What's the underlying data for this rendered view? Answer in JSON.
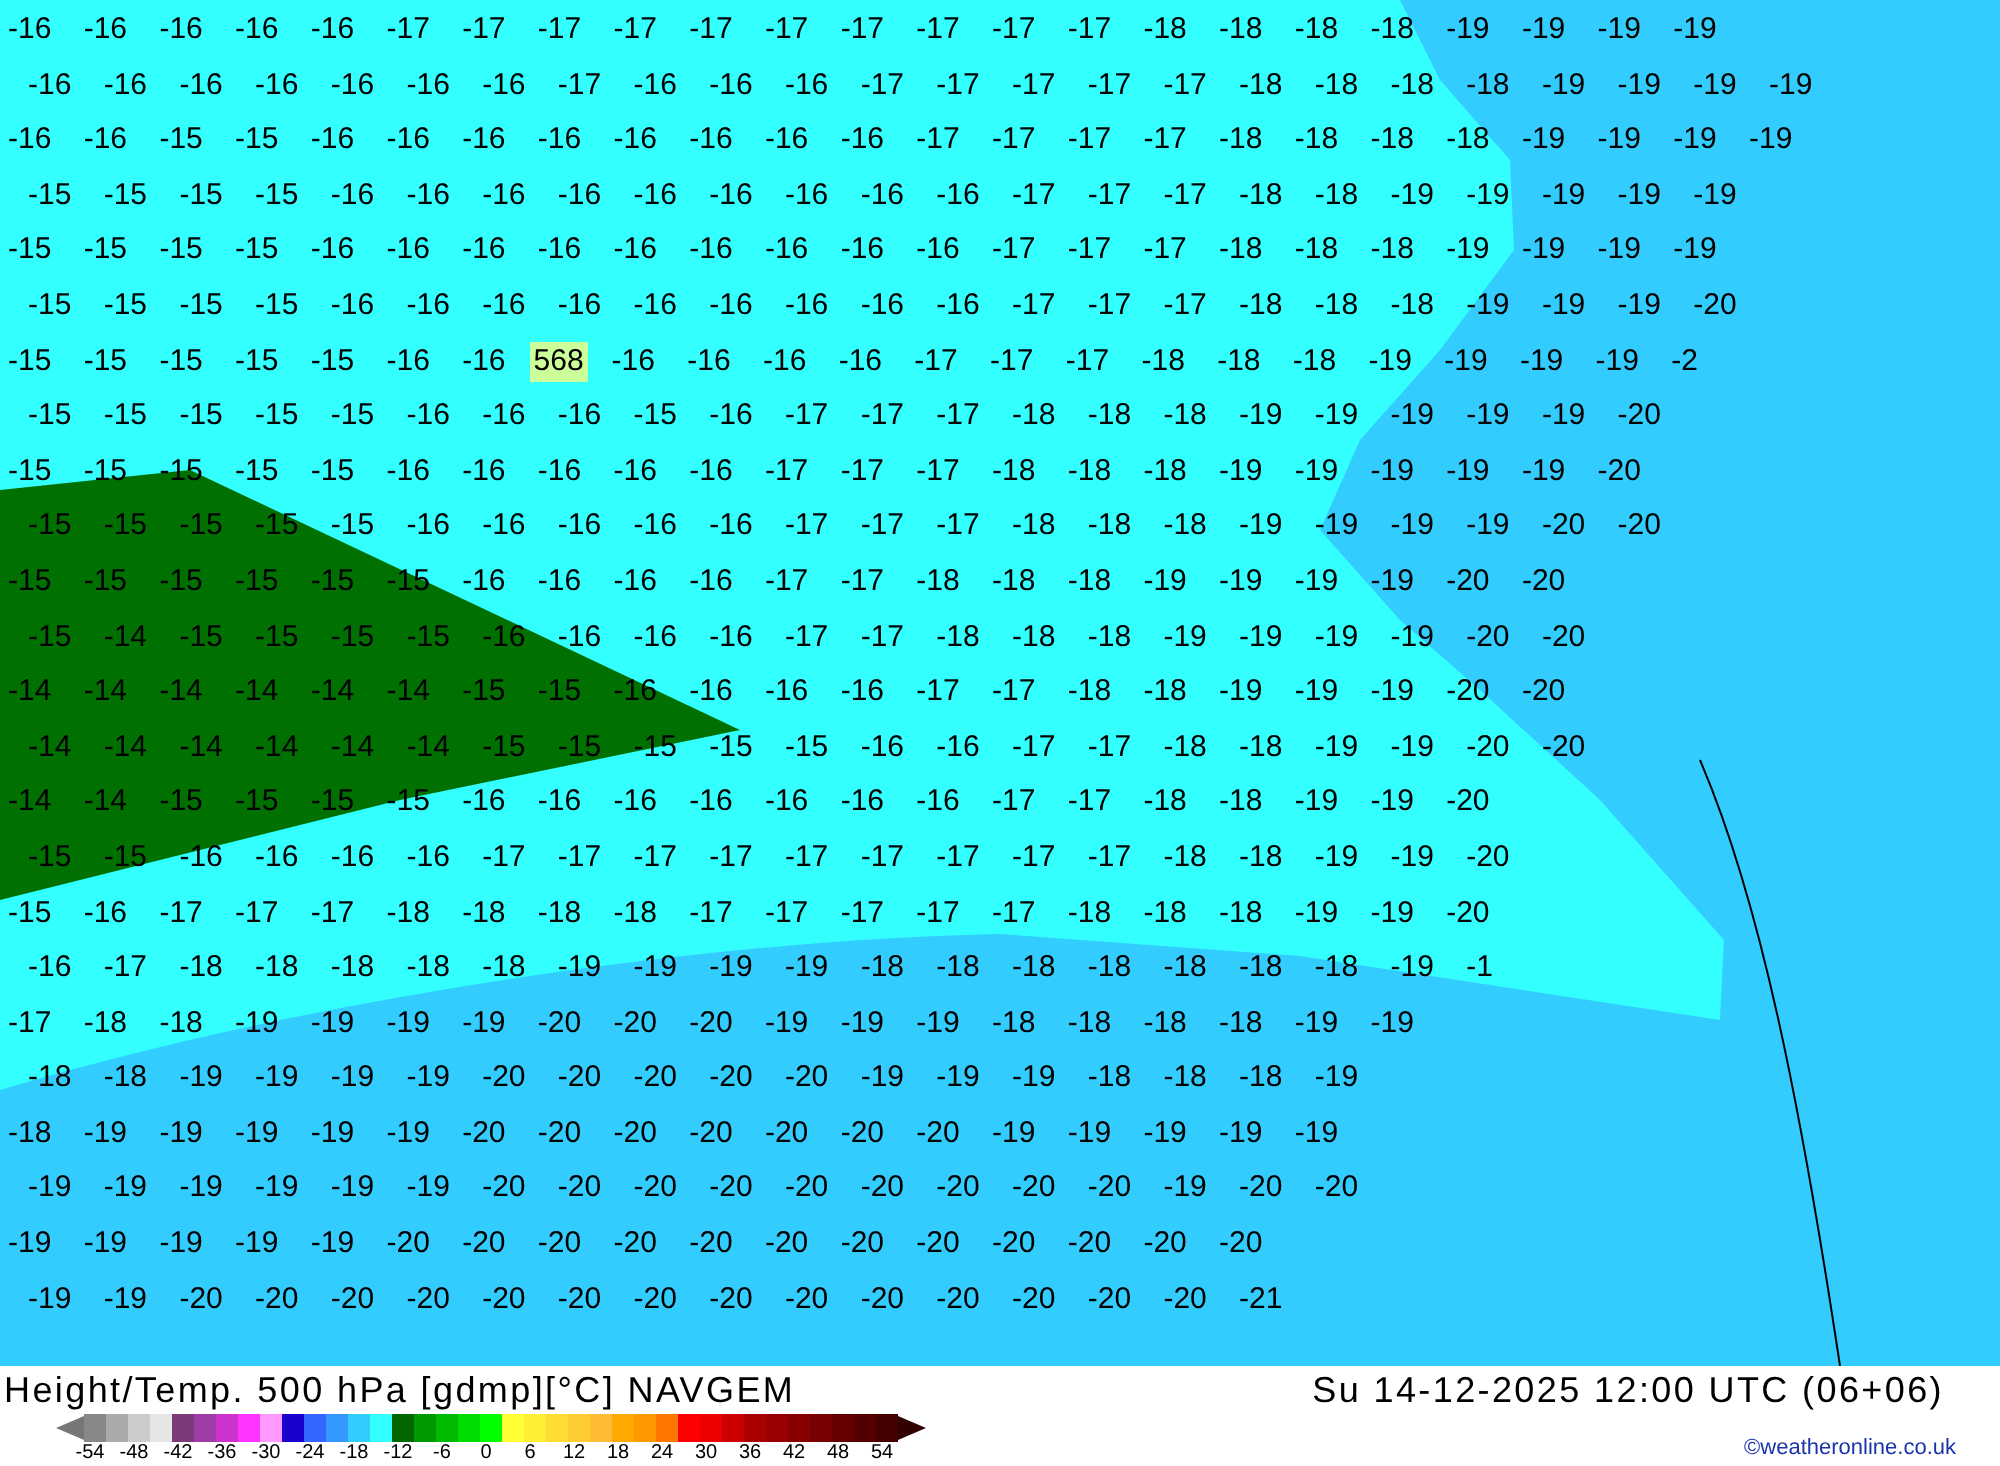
{
  "map": {
    "rows": [
      "-16 -16 -16 -16 -16 -17 -17 -17 -17 -17 -17 -17 -17 -17 -17 -18 -18 -18 -18 -19 -19 -19 -19",
      "-16 -16 -16 -16 -16 -16 -16 -17 -16 -16 -16 -17 -17 -17 -17 -17 -18 -18 -18 -18 -19 -19 -19 -19",
      "-16 -16 -15 -15 -16 -16 -16 -16 -16 -16 -16 -16 -17 -17 -17 -17 -18 -18 -18 -18 -19 -19 -19 -19",
      "-15 -15 -15 -15 -16 -16 -16 -16 -16 -16 -16 -16 -16 -17 -17 -17 -18 -18 -19 -19 -19 -19 -19",
      "-15 -15 -15 -15 -16 -16 -16 -16 -16 -16 -16 -16 -16 -17 -17 -17 -18 -18 -18 -19 -19 -19 -19",
      "-15 -15 -15 -15 -16 -16 -16 -16 -16 -16 -16 -16 -16 -17 -17 -17 -18 -18 -18 -19 -19 -19 -20",
      {
        "segments": [
          "-15 -15 -15 -15 -15 -16 -16",
          "-16 -16 -16 -16 -17 -17 -17 -18 -18 -18 -19 -19 -19 -19 -2"
        ],
        "contour_label": "568"
      },
      "-15 -15 -15 -15 -15 -16 -16 -16 -15 -16 -17 -17 -17 -18 -18 -18 -19 -19 -19 -19 -19 -20",
      "-15 -15 -15 -15 -15 -16 -16 -16 -16 -16 -17 -17 -17 -18 -18 -18 -19 -19 -19 -19 -19 -20",
      "-15 -15 -15 -15 -15 -16 -16 -16 -16 -16 -17 -17 -17 -18 -18 -18 -19 -19 -19 -19 -20 -20",
      "-15 -15 -15 -15 -15 -15 -16 -16 -16 -16 -17 -17 -18 -18 -18 -19 -19 -19 -19 -20 -20",
      "-15 -14 -15 -15 -15 -15 -16 -16 -16 -16 -17 -17 -18 -18 -18 -19 -19 -19 -19 -20 -20",
      "-14 -14 -14 -14 -14 -14 -15 -15 -16 -16 -16 -16 -17 -17 -18 -18 -19 -19 -19 -20 -20",
      "-14 -14 -14 -14 -14 -14 -15 -15 -15 -15 -15 -16 -16 -17 -17 -18 -18 -19 -19 -20 -20",
      "-14 -14 -15 -15 -15 -15 -16 -16 -16 -16 -16 -16 -16 -17 -17 -18 -18 -19 -19 -20",
      "-15 -15 -16 -16 -16 -16 -17 -17 -17 -17 -17 -17 -17 -17 -17 -18 -18 -19 -19 -20",
      "-15 -16 -17 -17 -17 -18 -18 -18 -18 -17 -17 -17 -17 -17 -18 -18 -18 -19 -19 -20",
      "-16 -17 -18 -18 -18 -18 -18 -19 -19 -19 -19 -18 -18 -18 -18 -18 -18 -18 -19 -1",
      "-17 -18 -18 -19 -19 -19 -19 -20 -20 -20 -19 -19 -19 -18 -18 -18 -18 -19 -19",
      "-18 -18 -19 -19 -19 -19 -20 -20 -20 -20 -20 -19 -19 -19 -18 -18 -18 -19",
      "-18 -19 -19 -19 -19 -19 -20 -20 -20 -20 -20 -20 -20 -19 -19 -19 -19 -19",
      "-19 -19 -19 -19 -19 -19 -20 -20 -20 -20 -20 -20 -20 -20 -20 -19 -20 -20",
      "-19 -19 -19 -19 -19 -20 -20 -20 -20 -20 -20 -20 -20 -20 -20 -20 -20",
      "-19 -19 -20 -20 -20 -20 -20 -20 -20 -20 -20 -20 -20 -20 -20 -20 -21"
    ]
  },
  "footer": {
    "title": "Height/Temp. 500 hPa [gdmp][°C] NAVGEM",
    "valid_time": "Su 14-12-2025 12:00 UTC (06+06)",
    "credit": "©weatheronline.co.uk"
  },
  "legend": {
    "swatches": [
      {
        "color": "#888888"
      },
      {
        "color": "#aaaaaa"
      },
      {
        "color": "#cccccc"
      },
      {
        "color": "#e6e6e6"
      },
      {
        "color": "#7b3a7a"
      },
      {
        "color": "#a03ca8"
      },
      {
        "color": "#cc33cc"
      },
      {
        "color": "#ff33ff"
      },
      {
        "color": "#ff99ff"
      },
      {
        "color": "#1a00cc"
      },
      {
        "color": "#3366ff"
      },
      {
        "color": "#3399ff"
      },
      {
        "color": "#33ccff"
      },
      {
        "color": "#33ffff"
      },
      {
        "color": "#006600"
      },
      {
        "color": "#009900"
      },
      {
        "color": "#00bb00"
      },
      {
        "color": "#00dd00"
      },
      {
        "color": "#00ff00"
      },
      {
        "color": "#ffff33"
      },
      {
        "color": "#ffee33"
      },
      {
        "color": "#ffdd33"
      },
      {
        "color": "#ffcc33"
      },
      {
        "color": "#ffbb33"
      },
      {
        "color": "#ffaa00"
      },
      {
        "color": "#ff9900"
      },
      {
        "color": "#ff7700"
      },
      {
        "color": "#ff0000"
      },
      {
        "color": "#ee0000"
      },
      {
        "color": "#cc0000"
      },
      {
        "color": "#aa0000"
      },
      {
        "color": "#990000"
      },
      {
        "color": "#880000"
      },
      {
        "color": "#770000"
      },
      {
        "color": "#660000"
      },
      {
        "color": "#550000"
      },
      {
        "color": "#440000"
      }
    ],
    "ticks": [
      "-54",
      "-48",
      "-42",
      "-36",
      "-30",
      "-24",
      "-18",
      "-12",
      "-6",
      "0",
      "6",
      "12",
      "18",
      "24",
      "30",
      "36",
      "42",
      "48",
      "54"
    ]
  }
}
